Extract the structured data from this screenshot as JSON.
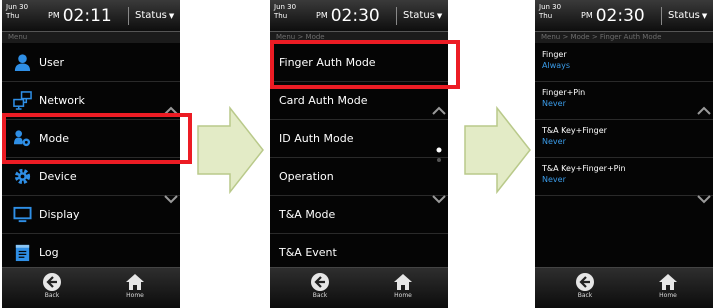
{
  "screens": [
    {
      "date_line1": "Jun 30",
      "date_line2": "Thu",
      "ampm": "PM",
      "time": "02:11",
      "status_label": "Status",
      "breadcrumb": "Menu",
      "menu_items": [
        {
          "label": "User",
          "icon": "user-icon"
        },
        {
          "label": "Network",
          "icon": "network-icon"
        },
        {
          "label": "Mode",
          "icon": "mode-icon"
        },
        {
          "label": "Device",
          "icon": "gear-icon"
        },
        {
          "label": "Display",
          "icon": "monitor-icon"
        },
        {
          "label": "Log",
          "icon": "log-icon"
        }
      ],
      "back_label": "Back",
      "home_label": "Home"
    },
    {
      "date_line1": "Jun 30",
      "date_line2": "Thu",
      "ampm": "PM",
      "time": "02:30",
      "status_label": "Status",
      "breadcrumb": "Menu > Mode",
      "menu_items": [
        {
          "label": "Finger Auth Mode"
        },
        {
          "label": "Card Auth Mode"
        },
        {
          "label": "ID Auth Mode"
        },
        {
          "label": "Operation"
        },
        {
          "label": "T&A Mode"
        },
        {
          "label": "T&A Event"
        }
      ],
      "back_label": "Back",
      "home_label": "Home"
    },
    {
      "date_line1": "Jun 30",
      "date_line2": "Thu",
      "ampm": "PM",
      "time": "02:30",
      "status_label": "Status",
      "breadcrumb": "Menu > Mode > Finger Auth Mode",
      "settings": [
        {
          "name": "Finger",
          "value": "Always"
        },
        {
          "name": "Finger+Pin",
          "value": "Never"
        },
        {
          "name": "T&A Key+Finger",
          "value": "Never"
        },
        {
          "name": "T&A Key+Finger+Pin",
          "value": "Never"
        }
      ],
      "back_label": "Back",
      "home_label": "Home"
    }
  ],
  "colors": {
    "highlight": "#ec1c24",
    "arrow_fill": "#e3ebc6",
    "arrow_stroke": "#b9c98a",
    "value_blue": "#3a9be8",
    "icon_blue": "#2f8fe6"
  }
}
